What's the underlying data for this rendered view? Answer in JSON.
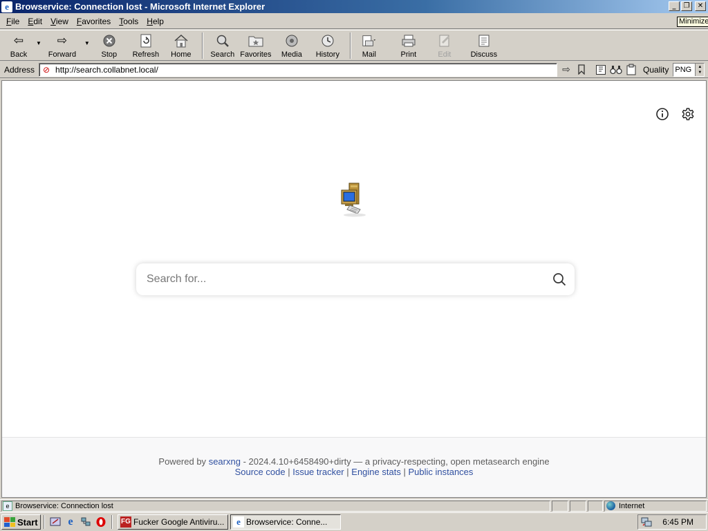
{
  "window": {
    "title": "Browservice: Connection lost - Microsoft Internet Explorer",
    "tooltip": "Minimize"
  },
  "menu": [
    "File",
    "Edit",
    "View",
    "Favorites",
    "Tools",
    "Help"
  ],
  "toolbar": {
    "back": "Back",
    "forward": "Forward",
    "stop": "Stop",
    "refresh": "Refresh",
    "home": "Home",
    "search": "Search",
    "favorites": "Favorites",
    "media": "Media",
    "history": "History",
    "mail": "Mail",
    "print": "Print",
    "edit": "Edit",
    "discuss": "Discuss"
  },
  "address": {
    "label": "Address",
    "url": "http://search.collabnet.local/",
    "quality_label": "Quality",
    "quality_value": "PNG"
  },
  "page": {
    "search_placeholder": "Search for...",
    "footer": {
      "powered_by": "Powered by",
      "searxng": "searxng",
      "version_text": "- 2024.4.10+6458490+dirty — a privacy-respecting, open metasearch engine",
      "source_code": "Source code",
      "sep": "|",
      "issue_tracker": "Issue tracker",
      "engine_stats": "Engine stats",
      "public_instances": "Public instances"
    }
  },
  "status": {
    "text": "Browservice: Connection lost",
    "zone": "Internet"
  },
  "taskbar": {
    "start": "Start",
    "tasks": [
      {
        "label": "Fucker Google Antiviru..."
      },
      {
        "label": "Browservice: Conne..."
      }
    ],
    "clock": "6:45 PM"
  },
  "colors": {
    "titlebar_start": "#0a246a",
    "titlebar_end": "#a6caf0",
    "link": "#3050a0",
    "chrome": "#d4d0c8"
  }
}
